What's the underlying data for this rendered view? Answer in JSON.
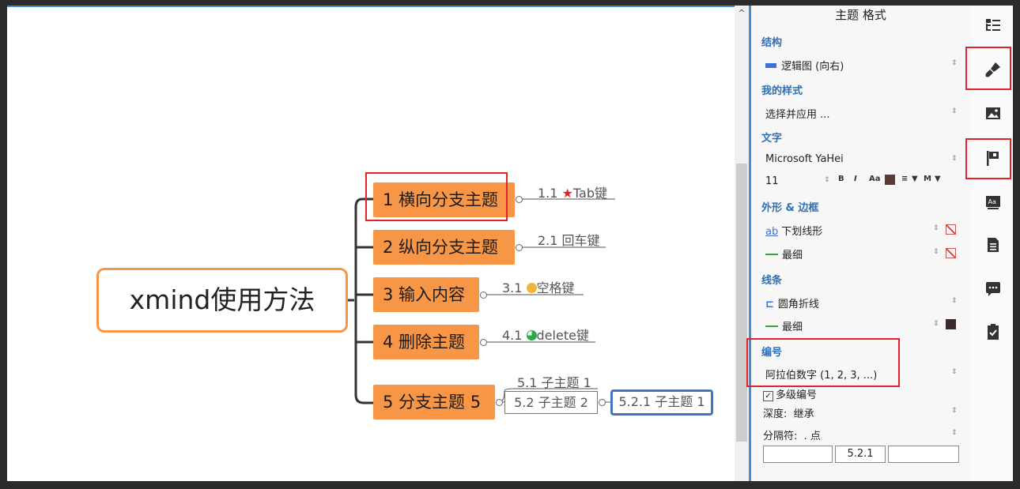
{
  "mindmap": {
    "root": "xmind使用方法",
    "topics": [
      {
        "label": "1 横向分支主题",
        "sub": "1.1",
        "sub_tail": "Tab键"
      },
      {
        "label": "2 纵向分支主题",
        "sub": "2.1 回车键"
      },
      {
        "label": "3 输入内容",
        "sub": "3.1",
        "sub_tail": "空格键"
      },
      {
        "label": "4 删除主题",
        "sub": "4.1",
        "sub_tail": "delete键"
      },
      {
        "label": "5 分支主题 5",
        "subs": [
          "5.1 子主题 1",
          "5.2 子主题 2"
        ],
        "subsub": "5.2.1 子主题 1"
      }
    ],
    "star": "★"
  },
  "panel": {
    "title": "主题 格式",
    "structure": {
      "heading": "结构",
      "value": "逻辑图 (向右)"
    },
    "my_style": {
      "heading": "我的样式",
      "value": "选择并应用 ..."
    },
    "text": {
      "heading": "文字",
      "font": "Microsoft YaHei",
      "size": "11",
      "bold": "B",
      "italic": "I",
      "case": "Aa",
      "align": "≡",
      "align_mode": "M"
    },
    "shape": {
      "heading": "外形 & 边框",
      "shape_icon_text": "ab",
      "shape_value": "下划线形",
      "border_value": "最细"
    },
    "line": {
      "heading": "线条",
      "style_value": "圆角折线",
      "width_value": "最细"
    },
    "numbering": {
      "heading": "编号",
      "format": "阿拉伯数字 (1, 2, 3, ...)",
      "multi_label": "多级编号",
      "depth_label": "深度:",
      "depth_value": "继承",
      "sep_label": "分隔符:",
      "sep_value": ". 点",
      "prefix": "",
      "preview": "5.2.1",
      "suffix": ""
    }
  },
  "scroll": {
    "up_arrow": "^"
  },
  "colors": {
    "topic": "#f79646",
    "accent": "#3d8fd6",
    "highlight": "#e3232c",
    "selected": "#4472c4"
  }
}
